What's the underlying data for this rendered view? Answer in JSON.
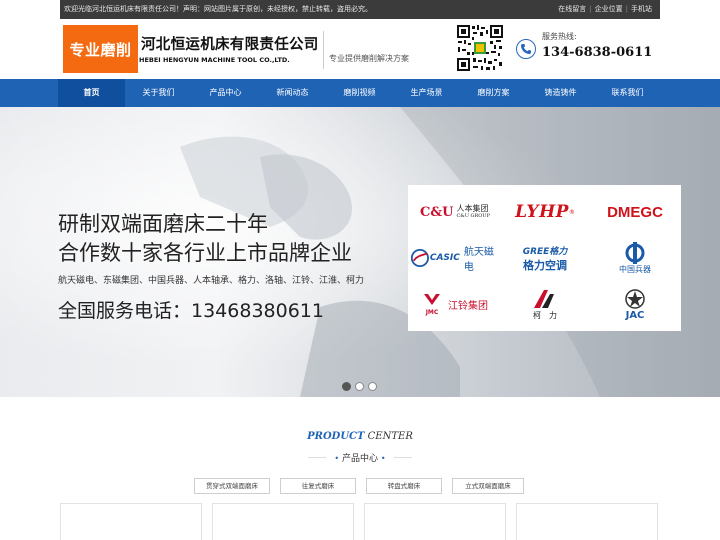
{
  "topbar": {
    "welcome": "欢迎光临河北恒运机床有限责任公司！声明：网站图片属于原创，未经授权，禁止转载，盗用必究。",
    "links": [
      "在线留言",
      "企业位置",
      "手机站"
    ]
  },
  "header": {
    "logo_badge": "专业磨削",
    "company_cn": "河北恒运机床有限责任公司",
    "company_en": "HEBEI HENGYUN MACHINE TOOL CO.,LTD.",
    "slogan": "专业提供磨削解决方案",
    "hotline_label": "服务热线:",
    "hotline_number": "134-6838-0611"
  },
  "nav": {
    "items": [
      "首页",
      "关于我们",
      "产品中心",
      "新闻动态",
      "磨削视频",
      "生产场景",
      "磨削方案",
      "铸造铸件",
      "联系我们"
    ],
    "active_index": 0
  },
  "banner": {
    "headline1": "研制双端面磨床二十年",
    "headline2": "合作数十家各行业上市品牌企业",
    "brands_line": "航天磁电、东磁集团、中国兵器、人本轴承、格力、洛轴、江铃、江淮、柯力",
    "hotline": "全国服务电话：13468380611",
    "logos": {
      "cu_mark": "C&U",
      "cu_cn": "人本集团",
      "cu_en": "C&U GROUP",
      "lyhp": "LYHP",
      "lyhp_reg": "®",
      "dmegc": "DMEGC",
      "casic_mark": "CASIC",
      "casic_cn": "航天磁电",
      "gree_en": "GREE格力",
      "gree_cn": "格力空调",
      "norinco_cn": "中国兵器",
      "jmc_en": "JMC",
      "jmc_cn": "江铃集团",
      "keli_cn": "柯　力",
      "jac_en": "JAC"
    },
    "slide_count": 3,
    "active_slide": 0
  },
  "product_center": {
    "title_en_1": "PRODUCT",
    "title_en_2": "CENTER",
    "title_cn": "产品中心",
    "categories": [
      "贯穿式双端面磨床",
      "往复式磨床",
      "转盘式磨床",
      "立式双端面磨床"
    ]
  },
  "colors": {
    "brand_blue": "#1f63b5",
    "logo_orange": "#f36a10",
    "topbar_bg": "#3b3b3b"
  }
}
